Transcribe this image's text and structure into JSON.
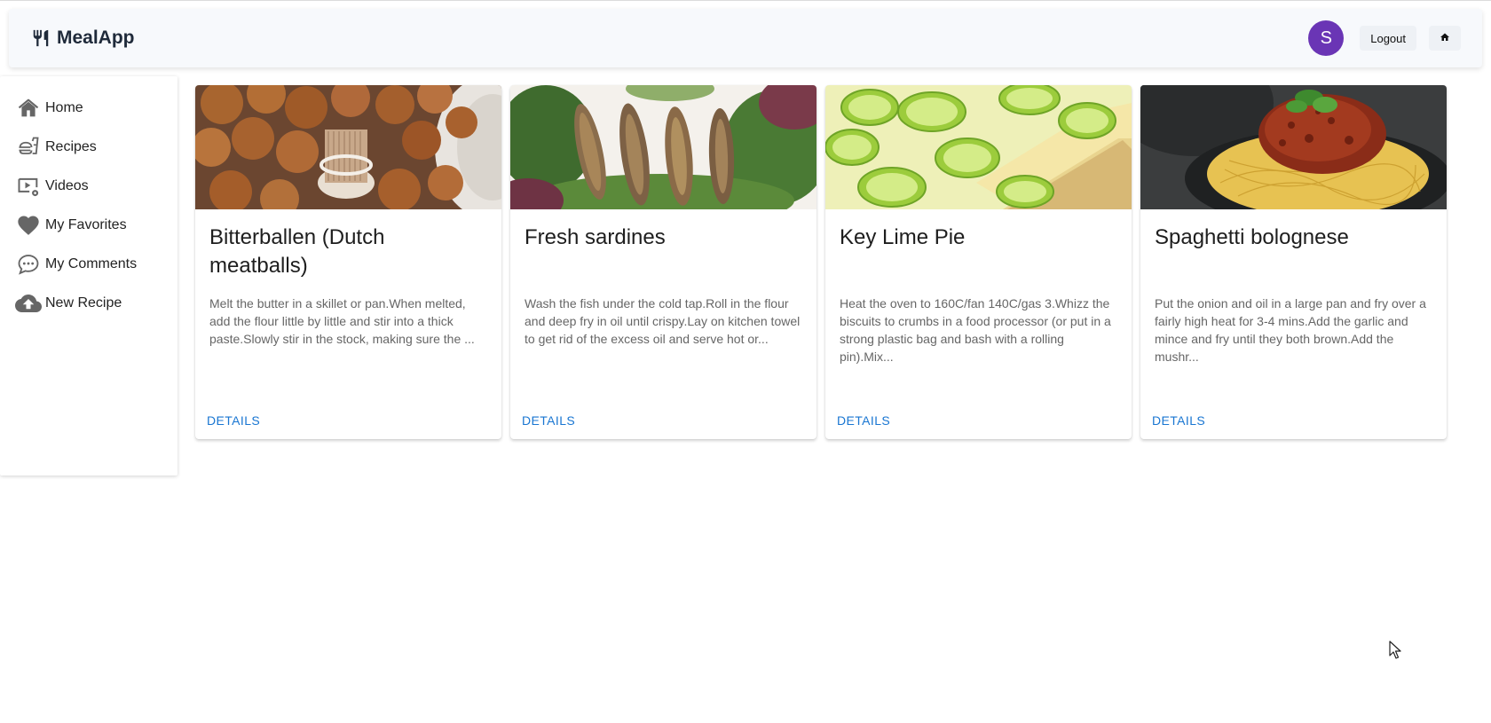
{
  "app": {
    "name": "MealApp",
    "brand_icon": "fork-knife-icon"
  },
  "header": {
    "avatar_initial": "S",
    "logout_label": "Logout",
    "home_icon": "house-icon",
    "avatar_color": "#6a35b5"
  },
  "sidebar": {
    "items": [
      {
        "label": "Home",
        "icon": "home-icon"
      },
      {
        "label": "Recipes",
        "icon": "recipes-icon"
      },
      {
        "label": "Videos",
        "icon": "video-settings-icon"
      },
      {
        "label": "My Favorites",
        "icon": "heart-icon"
      },
      {
        "label": "My Comments",
        "icon": "comment-icon"
      },
      {
        "label": "New Recipe",
        "icon": "cloud-upload-icon"
      }
    ]
  },
  "cards": [
    {
      "title": "Bitterballen (Dutch meatballs)",
      "description": "Melt the butter in a skillet or pan.When melted, add the flour little by little and stir into a thick paste.Slowly stir in the stock, making sure the ...",
      "action": "DETAILS"
    },
    {
      "title": "Fresh sardines",
      "description": "Wash the fish under the cold tap.Roll in the flour and deep fry in oil until crispy.Lay on kitchen towel to get rid of the excess oil and serve hot or...",
      "action": "DETAILS"
    },
    {
      "title": "Key Lime Pie",
      "description": "Heat the oven to 160C/fan 140C/gas 3.Whizz the biscuits to crumbs in a food processor (or put in a strong plastic bag and bash with a rolling pin).Mix...",
      "action": "DETAILS"
    },
    {
      "title": "Spaghetti bolognese",
      "description": "Put the onion and oil in a large pan and fry over a fairly high heat for 3-4 mins.Add the garlic and mince and fry until they both brown.Add the mushr...",
      "action": "DETAILS"
    }
  ],
  "colors": {
    "accent": "#1976d2",
    "avatar": "#6a35b5",
    "header_bg": "#f7f9fc"
  }
}
